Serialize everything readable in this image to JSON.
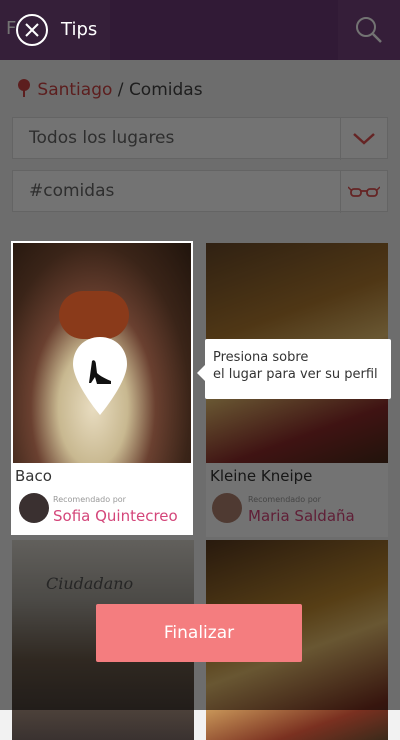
{
  "header": {
    "title_partial": "F"
  },
  "breadcrumb": {
    "city": "Santiago",
    "separator": "/",
    "category": "Comidas"
  },
  "filter": {
    "place_select": "Todos los lugares",
    "tag_field": "#comidas"
  },
  "cards": [
    {
      "name": "Baco",
      "rec_label": "Recomendado por",
      "rec_name": "Sofia Quintecreo"
    },
    {
      "name": "Kleine Kneipe",
      "rec_label": "Recomendado por",
      "rec_name": "Maria Saldaña"
    },
    {
      "name": "",
      "sign_text": "Ciudadano"
    },
    {
      "name": ""
    }
  ],
  "tips": {
    "label": "Tips",
    "tooltip_line1": "Presiona sobre",
    "tooltip_line2": "el lugar para ver su perfil"
  },
  "finalize_label": "Finalizar",
  "colors": {
    "header": "#6e3a78",
    "accent": "#d4467a",
    "button": "#f47d7f"
  }
}
